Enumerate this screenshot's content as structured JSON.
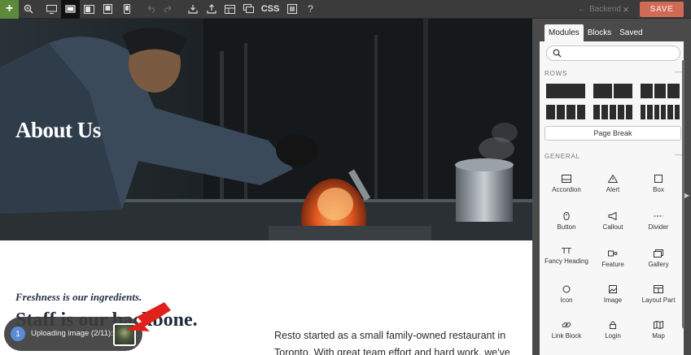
{
  "toolbar": {
    "add_label": "+",
    "css_label": "CSS",
    "help_label": "?",
    "backend_label": "Backend",
    "close_label": "×",
    "save_label": "SAVE"
  },
  "hero": {
    "title": "About Us"
  },
  "content": {
    "tagline": "Freshness is our ingredients.",
    "headline": "Staff is our backbone.",
    "body": "Resto started as a small family-owned restaurant in Toronto. With great team effort and hard work, we've"
  },
  "upload": {
    "badge": "1",
    "text": "Uploading image (2/11):"
  },
  "panel": {
    "tabs": [
      "Modules",
      "Blocks",
      "Saved"
    ],
    "search_placeholder": "",
    "rows_header": "ROWS",
    "page_break_label": "Page Break",
    "general_header": "GENERAL",
    "collapse_label": "—",
    "modules": [
      "Accordion",
      "Alert",
      "Box",
      "Button",
      "Callout",
      "Divider",
      "Fancy Heading",
      "Feature",
      "Gallery",
      "Icon",
      "Image",
      "Layout Part",
      "Link Block",
      "Login",
      "Map"
    ]
  },
  "colors": {
    "save": "#cf6a55",
    "add": "#5a8a3a",
    "badge": "#5b8bd6",
    "arrow": "#e0201a"
  }
}
